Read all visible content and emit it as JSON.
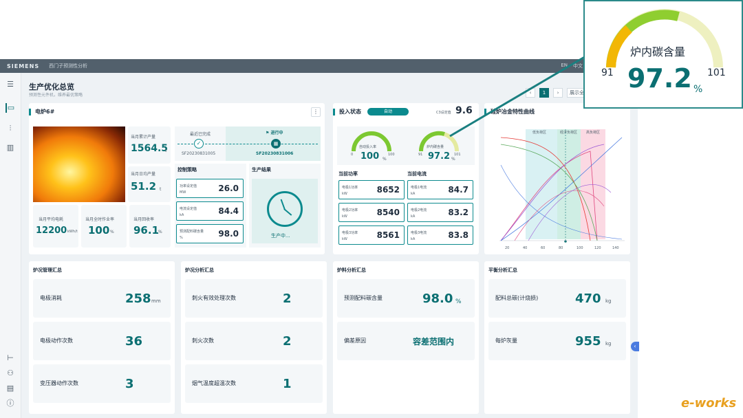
{
  "topbar": {
    "brand": "SIEMENS",
    "app": "西门子预测性分析",
    "lang_en": "EN",
    "lang_zh": "中文",
    "user": "admin"
  },
  "page": {
    "title": "生产优化总览",
    "subtitle": "预测性元件机，维养最优策略",
    "page_num": "1",
    "view_btn": "展示全屏"
  },
  "furnace": {
    "title": "电炉6#",
    "month_output_label": "当月累计产量",
    "month_output": "1564.5",
    "month_output_unit": "t",
    "day_output_label": "当月日均产量",
    "day_output": "51.2",
    "day_output_unit": "t",
    "avg_power_label": "当月平均电耗",
    "avg_power": "12200",
    "avg_power_unit": "kWh/t",
    "rate_label": "当月全时作业率",
    "rate": "100",
    "rate_unit": "%",
    "recovery_label": "当月回收率",
    "recovery": "96.1",
    "recovery_unit": "%"
  },
  "timeline": {
    "done_label": "最近已完成",
    "done_id": "SF20230831005",
    "running_label": "进行中",
    "running_id": "SF20230831006"
  },
  "strategy": {
    "title": "控制策略",
    "items": [
      {
        "label": "功率设定值",
        "unit": "MW",
        "value": "26.0"
      },
      {
        "label": "电流设定值",
        "unit": "kA",
        "value": "84.4"
      },
      {
        "label": "预测配料碳含量",
        "unit": "%",
        "value": "98.0"
      }
    ]
  },
  "result": {
    "title": "生产结果",
    "status": "生产中..."
  },
  "input_status": {
    "title": "投入状态",
    "mode": "自动",
    "cycle_label": "C3设定值",
    "cycle_value": "9.6",
    "gauge1": {
      "label": "自动投入率",
      "min": "0",
      "max": "100",
      "value": "100",
      "unit": "%",
      "fill": 1.0
    },
    "gauge2": {
      "label": "炉内碳含量",
      "min": "91",
      "max": "101",
      "value": "97.2",
      "unit": "%",
      "fill": 0.62
    },
    "power_title": "当前功率",
    "current_title": "当前电流",
    "powers": [
      {
        "label": "电极1功率",
        "unit": "kW",
        "value": "8652"
      },
      {
        "label": "电极2功率",
        "unit": "kW",
        "value": "8540"
      },
      {
        "label": "电极3功率",
        "unit": "kW",
        "value": "8561"
      }
    ],
    "currents": [
      {
        "label": "电极1电流",
        "unit": "kA",
        "value": "84.7"
      },
      {
        "label": "电极2电流",
        "unit": "kA",
        "value": "83.2"
      },
      {
        "label": "电极3电流",
        "unit": "kA",
        "value": "83.8"
      }
    ]
  },
  "curve": {
    "title": "硅炉冶金特性曲线",
    "band1": "低负荷区",
    "band2": "经济负荷区",
    "band3": "高负荷区",
    "x_ticks": [
      "20",
      "40",
      "60",
      "80",
      "100",
      "120",
      "140"
    ]
  },
  "summaries": [
    {
      "title": "炉况管理汇总",
      "rows": [
        {
          "label": "电极消耗",
          "value": "258",
          "unit": "mm"
        },
        {
          "label": "电极动作次数",
          "value": "36",
          "unit": ""
        },
        {
          "label": "变压器动作次数",
          "value": "3",
          "unit": ""
        }
      ]
    },
    {
      "title": "炉况分析汇总",
      "rows": [
        {
          "label": "刺火有效处理次数",
          "value": "2",
          "unit": ""
        },
        {
          "label": "刺火次数",
          "value": "2",
          "unit": ""
        },
        {
          "label": "烟气温度超温次数",
          "value": "1",
          "unit": ""
        }
      ]
    },
    {
      "title": "炉料分析汇总",
      "rows": [
        {
          "label": "预测配料碳含量",
          "value": "98.0",
          "unit": "%"
        },
        {
          "label": "偏差原因",
          "value": "容差范围内",
          "unit": ""
        }
      ]
    },
    {
      "title": "平衡分析汇总",
      "rows": [
        {
          "label": "配料总碳(计烧损)",
          "value": "470",
          "unit": "kg"
        },
        {
          "label": "每炉灰量",
          "value": "955",
          "unit": "kg"
        }
      ]
    }
  ],
  "callout": {
    "label": "炉内碳含量",
    "min": "91",
    "max": "101",
    "value": "97.2",
    "unit": "%"
  },
  "watermark": "e-works",
  "colors": {
    "teal": "#0b6f72",
    "accent": "#0b8a8e",
    "green": "#7cc832",
    "yellow": "#f2b705"
  }
}
